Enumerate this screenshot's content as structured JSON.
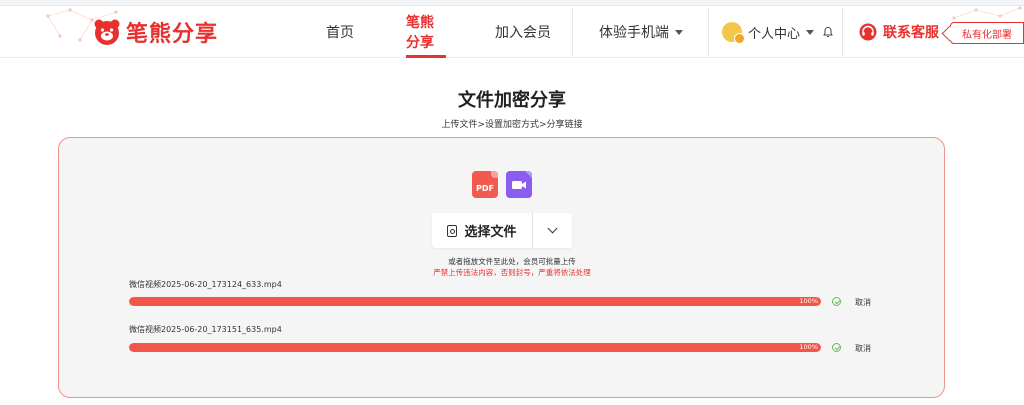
{
  "header": {
    "brand": "笔熊分享",
    "nav": [
      {
        "label": "首页",
        "active": false
      },
      {
        "label": "笔熊分享",
        "active": true
      },
      {
        "label": "加入会员",
        "active": false
      },
      {
        "label": "体验手机端",
        "active": false,
        "dropdown": true
      }
    ],
    "user_center": "个人中心",
    "service": "联系客服",
    "private_deploy": "私有化部署"
  },
  "page": {
    "title": "文件加密分享",
    "steps": "上传文件>设置加密方式>分享链接"
  },
  "upload": {
    "pdf_icon_text": "PDF",
    "select_button": "选择文件",
    "hint": "或者拖放文件至此处，会员可批量上传",
    "warning": "严禁上传违法内容，否则封号，严重将依法处理",
    "files": [
      {
        "name": "微信视频2025-06-20_173124_633.mp4",
        "progress": 100,
        "progress_label": "100%",
        "cancel": "取消"
      },
      {
        "name": "微信视频2025-06-20_173151_635.mp4",
        "progress": 100,
        "progress_label": "100%",
        "cancel": "取消"
      }
    ]
  },
  "colors": {
    "accent": "#e8312f",
    "progress": "#f2564b",
    "video_icon": "#8b5cf0",
    "success": "#66bb55"
  }
}
